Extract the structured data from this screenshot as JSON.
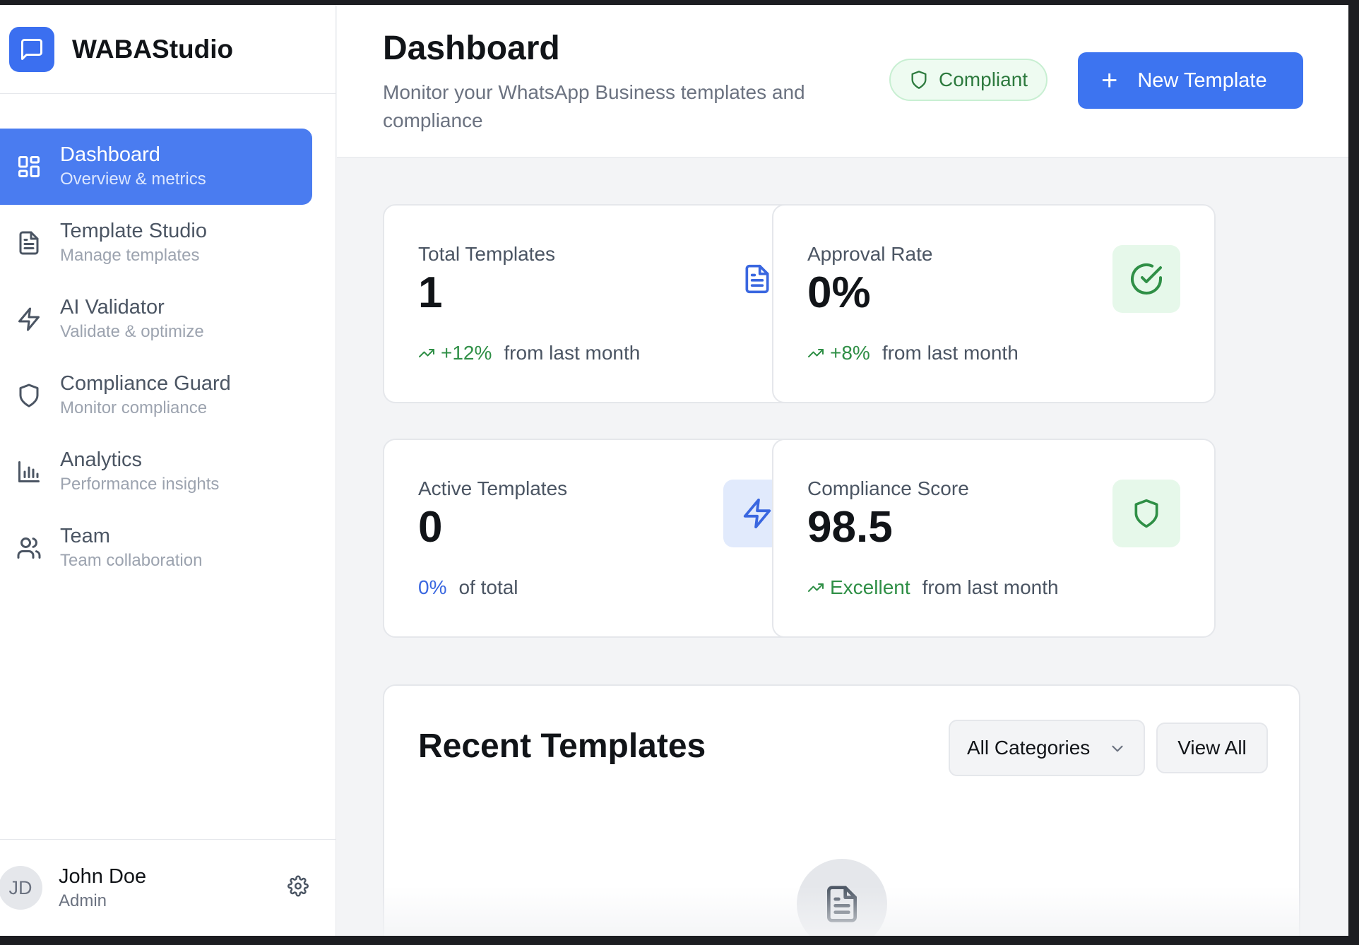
{
  "app": {
    "name": "WABAStudio",
    "logo_icon": "message-square-icon",
    "accent": "#3d74f0"
  },
  "sidebar": {
    "items": [
      {
        "label": "Dashboard",
        "sub": "Overview & metrics",
        "icon": "layout-grid-icon",
        "active": true
      },
      {
        "label": "Template Studio",
        "sub": "Manage templates",
        "icon": "file-text-icon"
      },
      {
        "label": "AI Validator",
        "sub": "Validate & optimize",
        "icon": "zap-icon"
      },
      {
        "label": "Compliance Guard",
        "sub": "Monitor compliance",
        "icon": "shield-icon"
      },
      {
        "label": "Analytics",
        "sub": "Performance insights",
        "icon": "bar-chart-icon"
      },
      {
        "label": "Team",
        "sub": "Team collaboration",
        "icon": "users-icon"
      }
    ]
  },
  "user": {
    "initials": "JD",
    "name": "John Doe",
    "role": "Admin"
  },
  "header": {
    "title": "Dashboard",
    "subtitle": "Monitor your WhatsApp Business templates and compliance",
    "badge": "Compliant",
    "new_button": "New Template",
    "new_button_icon": "+"
  },
  "stats": [
    {
      "label": "Total Templates",
      "value": "1",
      "delta": "+12%",
      "rest": "from last month",
      "delta_color": "#2f8f46",
      "icon": "file-text-icon"
    },
    {
      "label": "Approval Rate",
      "value": "0%",
      "delta": "+8%",
      "rest": "from last month",
      "delta_color": "#2f8f46",
      "icon": "check-circle-icon"
    },
    {
      "label": "Active Templates",
      "value": "0",
      "delta": "0%",
      "rest": "of total",
      "delta_color": "#3a67e0",
      "icon": "zap-icon"
    },
    {
      "label": "Compliance Score",
      "value": "98.5",
      "delta": "Excellent",
      "rest": "from last month",
      "delta_color": "#2f8f46",
      "icon": "shield-icon"
    }
  ],
  "recent": {
    "title": "Recent Templates",
    "category_select": "All Categories",
    "view_all": "View All"
  }
}
